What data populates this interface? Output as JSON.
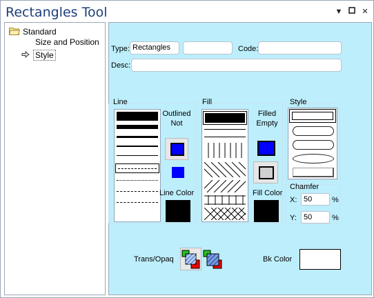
{
  "window": {
    "title": "Rectangles Tool",
    "buttons": {
      "menu": "▼",
      "restore": "▢",
      "close": "✕"
    }
  },
  "tree": {
    "items": [
      {
        "label": "Standard"
      },
      {
        "label": "Size and Position"
      },
      {
        "label": "Style"
      }
    ]
  },
  "form": {
    "type_label": "Type:",
    "type_value": "Rectangles",
    "type_value2": "",
    "code_label": "Code:",
    "code_value": "",
    "desc_label": "Desc:",
    "desc_value": ""
  },
  "line": {
    "title": "Line",
    "outline_label": "Outlined Not",
    "color_label": "Line Color"
  },
  "fill": {
    "title": "Fill",
    "filled_label": "Filled Empty",
    "color_label": "Fill Color"
  },
  "style": {
    "title": "Style"
  },
  "chamfer": {
    "title": "Chamfer",
    "x_label": "X:",
    "x_value": "50",
    "x_unit": "%",
    "y_label": "Y:",
    "y_value": "50",
    "y_unit": "%"
  },
  "bottom": {
    "trans_label": "Trans/Opaq",
    "bk_label": "Bk Color"
  },
  "colors": {
    "panel": "#bdeefc",
    "blue": "#0000ff",
    "black": "#000000",
    "title": "#1e3f7a"
  }
}
